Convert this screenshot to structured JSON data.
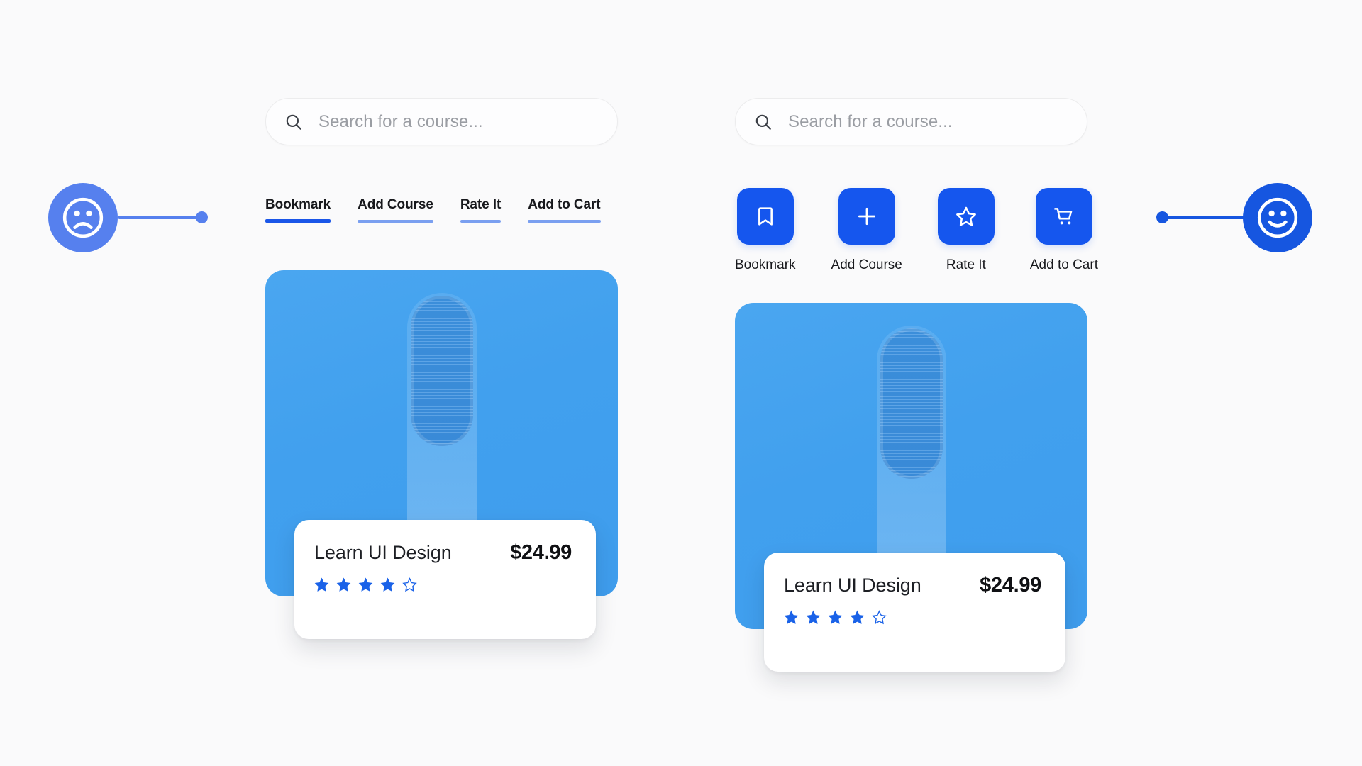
{
  "page": {
    "background_color": "#fafafb",
    "accent_primary": "#1556ee",
    "accent_secondary": "#5680ee",
    "thumb_color": "#43a2ef"
  },
  "markers": {
    "left": {
      "icon": "sad-face-icon",
      "label": "sad",
      "color": "#5680ee"
    },
    "right": {
      "icon": "happy-face-icon",
      "label": "happy",
      "color": "#1656e0"
    }
  },
  "left_panel": {
    "search": {
      "icon": "search-icon",
      "placeholder": "Search for a course...",
      "value": ""
    },
    "tabs": [
      {
        "label": "Bookmark",
        "active": true
      },
      {
        "label": "Add Course",
        "active": false
      },
      {
        "label": "Rate It",
        "active": false
      },
      {
        "label": "Add to Cart",
        "active": false
      }
    ],
    "card": {
      "title": "Learn UI Design",
      "price": "$24.99",
      "rating_filled": 4,
      "rating_total": 5
    }
  },
  "right_panel": {
    "search": {
      "icon": "search-icon",
      "placeholder": "Search for a course...",
      "value": ""
    },
    "actions": [
      {
        "label": "Bookmark",
        "icon": "bookmark-icon"
      },
      {
        "label": "Add Course",
        "icon": "plus-icon"
      },
      {
        "label": "Rate It",
        "icon": "star-icon"
      },
      {
        "label": "Add to Cart",
        "icon": "cart-icon"
      }
    ],
    "card": {
      "title": "Learn UI Design",
      "price": "$24.99",
      "rating_filled": 4,
      "rating_total": 5
    }
  }
}
